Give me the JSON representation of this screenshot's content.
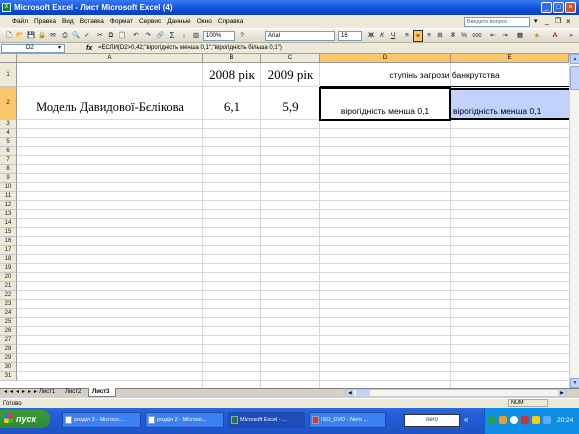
{
  "window": {
    "title": "Microsoft Excel - Лист Microsoft Excel (4)",
    "app_icon": "excel-icon",
    "buttons": [
      "_",
      "□",
      "×"
    ]
  },
  "menu": {
    "items": [
      "Файл",
      "Правка",
      "Вид",
      "Вставка",
      "Формат",
      "Сервис",
      "Данные",
      "Окно",
      "Справка"
    ],
    "help_placeholder": "Введите вопрос"
  },
  "toolbar": {
    "zoom": "100%",
    "font_name": "Arial",
    "font_size": "16",
    "bold": "Ж",
    "italic": "К",
    "underline": "Ч",
    "sum": "Σ",
    "percent": "%",
    "thousands": "000"
  },
  "formula_bar": {
    "name_box": "D2",
    "fx": "fx",
    "formula": "=ЕСЛИ(D2>0,42;\"вірогідність менша 0,1\";\"вірогідність більша 0,1\")"
  },
  "sheet": {
    "columns": [
      "A",
      "B",
      "C",
      "D",
      "E"
    ],
    "rows": [
      "1",
      "2",
      "3",
      "4",
      "5",
      "6",
      "7",
      "8",
      "9",
      "10",
      "11",
      "12",
      "13",
      "14",
      "15",
      "16",
      "17",
      "18",
      "19",
      "20",
      "21",
      "22",
      "23",
      "24",
      "25",
      "26",
      "27",
      "28",
      "29",
      "30",
      "31"
    ],
    "cells": {
      "B1": "2008 рік",
      "C1": "2009 рік",
      "D1": "ступінь загрози банкрутства",
      "A2": "Модель Давидової-Бєлікова",
      "B2": "6,1",
      "C2": "5,9",
      "D2": "вірогідність менша 0,1",
      "E2": "вірогідність менша 0,1"
    },
    "selected_cell": "D2",
    "tabs": [
      "Лист1",
      "Лист2",
      "Лист3"
    ],
    "active_tab": "Лист3"
  },
  "status_bar": {
    "left": "Готово",
    "right": "NUM"
  },
  "taskbar": {
    "start_label": "пуск",
    "tasks": [
      "розділ 3 - Microso...",
      "розділ 2 - Microso...",
      "Microsoft Excel - ...",
      "ISO_DVD - Nero ..."
    ],
    "active_task_index": 2,
    "nero_label": "nero",
    "clock": "20:24"
  },
  "colors": {
    "title_bar": "#0c4fd8",
    "selection": "#c1d3fb",
    "header_selected": "#f9c66b",
    "taskbar": "#245edb",
    "start_button": "#2e8b2e"
  }
}
